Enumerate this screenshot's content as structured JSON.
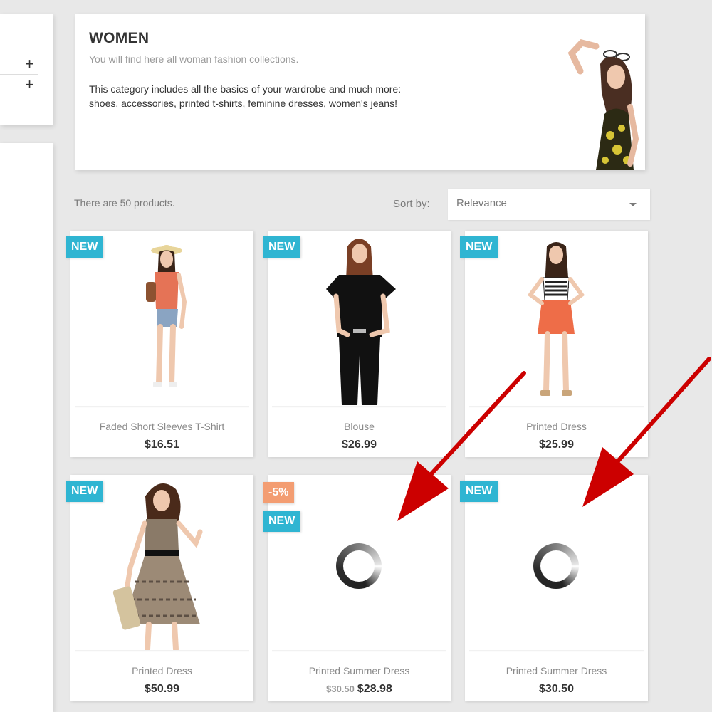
{
  "sidebar": {
    "facets": [
      {
        "expand_symbol": "+"
      },
      {
        "expand_symbol": "+"
      }
    ]
  },
  "category": {
    "title": "WOMEN",
    "subtitle": "You will find here all woman fashion collections.",
    "description_line1": "This category includes all the basics of your wardrobe and much more:",
    "description_line2": "shoes, accessories, printed t-shirts, feminine dresses, women's jeans!"
  },
  "listing": {
    "product_count_text": "There are 50 products.",
    "sort_label": "Sort by:",
    "sort_value": "Relevance"
  },
  "products": [
    {
      "name": "Faded Short Sleeves T-Shirt",
      "price": "$16.51",
      "badge_new": "NEW"
    },
    {
      "name": "Blouse",
      "price": "$26.99",
      "badge_new": "NEW"
    },
    {
      "name": "Printed Dress",
      "price": "$25.99",
      "badge_new": "NEW"
    },
    {
      "name": "Printed Dress",
      "price": "$50.99",
      "badge_new": "NEW"
    },
    {
      "name": "Printed Summer Dress",
      "price": "$28.98",
      "old_price": "$30.50",
      "badge_discount": "-5%",
      "badge_new": "NEW",
      "image_state": "loading"
    },
    {
      "name": "Printed Summer Dress",
      "price": "$30.50",
      "badge_new": "NEW",
      "image_state": "loading"
    }
  ],
  "colors": {
    "accent_new_badge": "#2fb5d2",
    "discount_badge": "#f39d72",
    "annotation_arrow": "#cc0000"
  }
}
